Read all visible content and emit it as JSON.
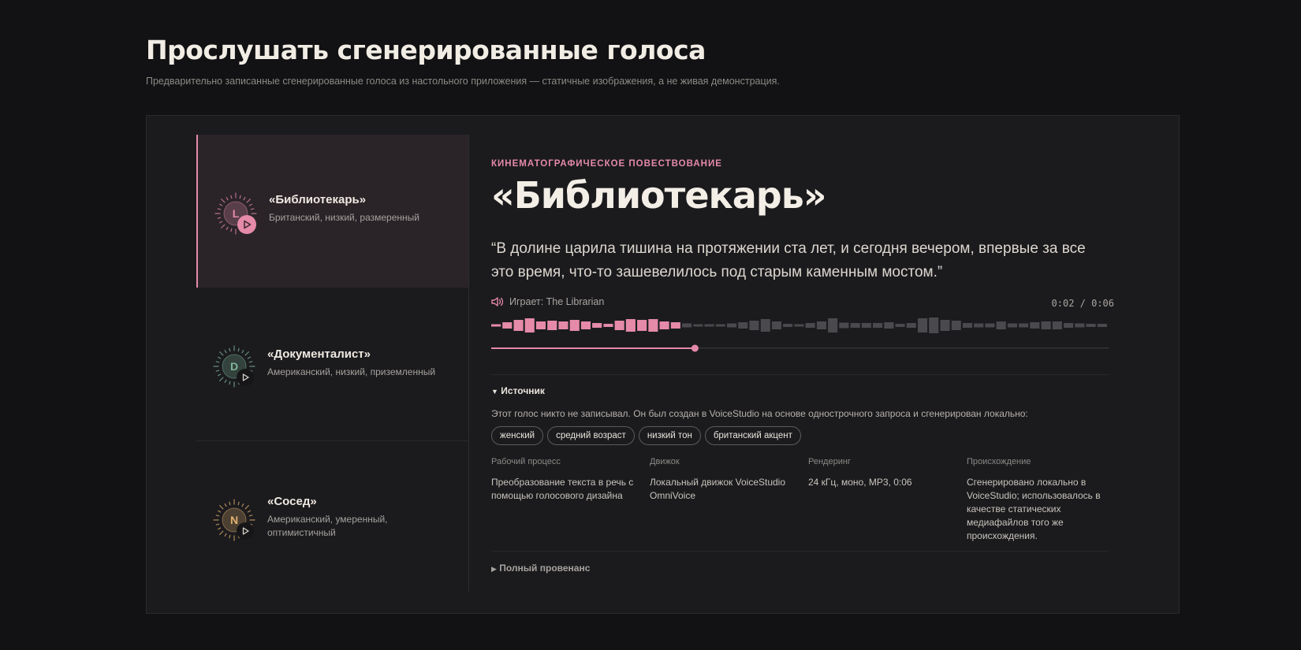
{
  "page": {
    "title": "Прослушать сгенерированные голоса",
    "subtitle": "Предварительно записанные сгенерированные голоса из настольного приложения — статичные изображения, а не живая демонстрация."
  },
  "voices": [
    {
      "letter": "L",
      "name": "«Библиотекарь»",
      "description": "Британский, низкий, размеренный",
      "color": "#e58aa8",
      "active": true
    },
    {
      "letter": "D",
      "name": "«Документалист»",
      "description": "Американский, низкий, приземленный",
      "color": "#7fb89a",
      "active": false
    },
    {
      "letter": "N",
      "name": "«Сосед»",
      "description": "Американский, умеренный, оптимистичный",
      "color": "#e0b070",
      "active": false
    }
  ],
  "detail": {
    "kicker": "КИНЕМАТОГРАФИЧЕСКОЕ ПОВЕСТВОВАНИЕ",
    "title": "«Библиотекарь»",
    "quote": "“В долине царила тишина на протяжении ста лет, и сегодня вечером, впервые за все это время, что-то зашевелилось под старым каменным мостом.”",
    "now_playing": "Играет: The Librarian",
    "time": "0:02 / 0:06",
    "progress": 0.33,
    "accent": "#e58aa8",
    "source_toggle": "Источник",
    "source_text": "Этот голос никто не записывал. Он был создан в VoiceStudio на основе однострочного запроса и сгенерирован локально:",
    "tags": [
      "женский",
      "средний возраст",
      "низкий тон",
      "британский акцент"
    ],
    "meta": [
      {
        "label": "Рабочий процесс",
        "value": "Преобразование текста в речь с помощью голосового дизайна"
      },
      {
        "label": "Движок",
        "value": "Локальный движок VoiceStudio OmniVoice"
      },
      {
        "label": "Рендеринг",
        "value": "24 кГц, моно, MP3, 0:06"
      },
      {
        "label": "Происхождение",
        "value": "Сгенерировано локально в VoiceStudio; использовалось в качестве статических медиафайлов того же происхождения."
      }
    ],
    "provenance_toggle": "Полный провенанс"
  }
}
